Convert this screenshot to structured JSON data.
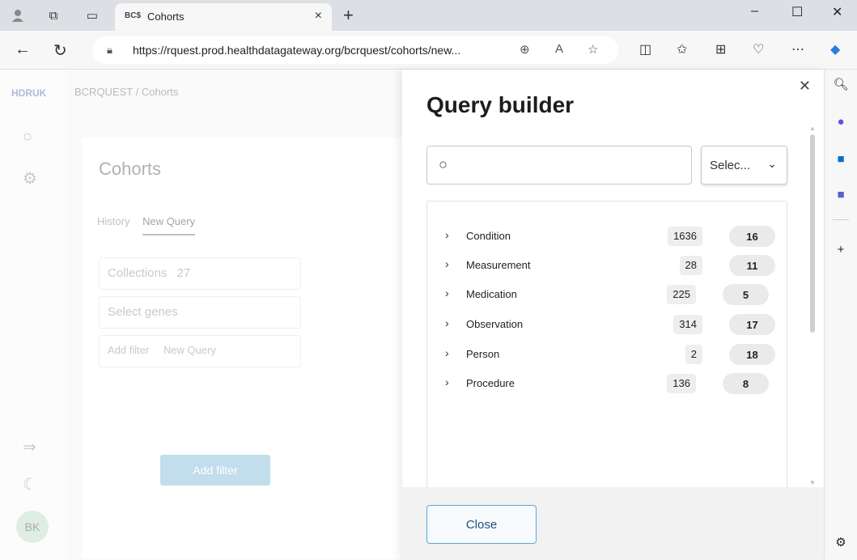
{
  "browser": {
    "tab": {
      "favicon": "BC$",
      "title": "Cohorts",
      "close": "×"
    },
    "new_tab": "+",
    "url": "https://rquest.prod.healthdatagateway.org/bcrquest/cohorts/new...",
    "window_controls": [
      "–",
      "☐",
      "✕"
    ]
  },
  "page": {
    "logo": "HDRUK",
    "breadcrumb": "BCRQUEST / Cohorts",
    "cohorts_title": "Cohorts",
    "tabs": {
      "history": "History",
      "new_query": "New Query"
    },
    "collections_label": "Collections",
    "collections_count": "27",
    "select_genes": "Select genes",
    "add_filter_inline": "Add filter",
    "new_query_name": "New Query",
    "add_filter_button": "Add filter",
    "avatar": "BK"
  },
  "query_builder": {
    "title": "Query builder",
    "search": {
      "value": "",
      "placeholder": ""
    },
    "select_label": "Selec...",
    "rows": [
      {
        "name": "Condition",
        "count": "1636",
        "pill": "16"
      },
      {
        "name": "Measurement",
        "count": "28",
        "pill": "11"
      },
      {
        "name": "Medication",
        "count": "225",
        "pill": "5"
      },
      {
        "name": "Observation",
        "count": "314",
        "pill": "17"
      },
      {
        "name": "Person",
        "count": "2",
        "pill": "18"
      },
      {
        "name": "Procedure",
        "count": "136",
        "pill": "8"
      }
    ],
    "close_label": "Close"
  },
  "icons": {
    "profile": "person-icon",
    "collections_tab": "tab-actions-icon",
    "vertical_tabs": "tab-strip-icon",
    "back": "back-arrow-icon",
    "refresh": "refresh-icon",
    "search": "search-icon"
  },
  "colors": {
    "accent": "#5ea8d4",
    "chrome_bg": "#dcdfe3",
    "footer_bg": "#f2f2f2"
  }
}
